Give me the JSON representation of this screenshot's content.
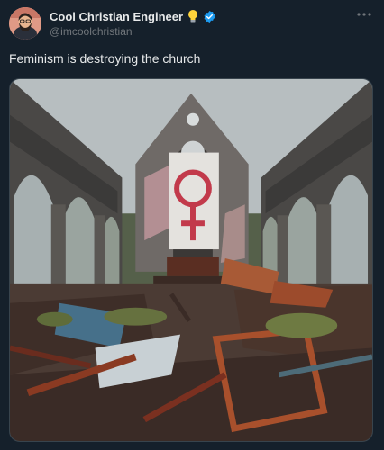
{
  "post": {
    "author": {
      "display_name": "Cool Christian Engineer",
      "handle": "@imcoolchristian",
      "avatar_icon": "avatar-bearded-man",
      "name_emoji": "lightbulb-icon",
      "verified": true,
      "verified_color": "#1d9bf0"
    },
    "text": "Feminism is destroying the church",
    "more_icon": "more-horizontal-icon",
    "media": {
      "type": "image",
      "description_icon": "ruined-church-photo"
    }
  },
  "colors": {
    "background": "#15202b",
    "text_primary": "#e7e9ea",
    "text_secondary": "#71767b",
    "accent": "#1d9bf0"
  }
}
